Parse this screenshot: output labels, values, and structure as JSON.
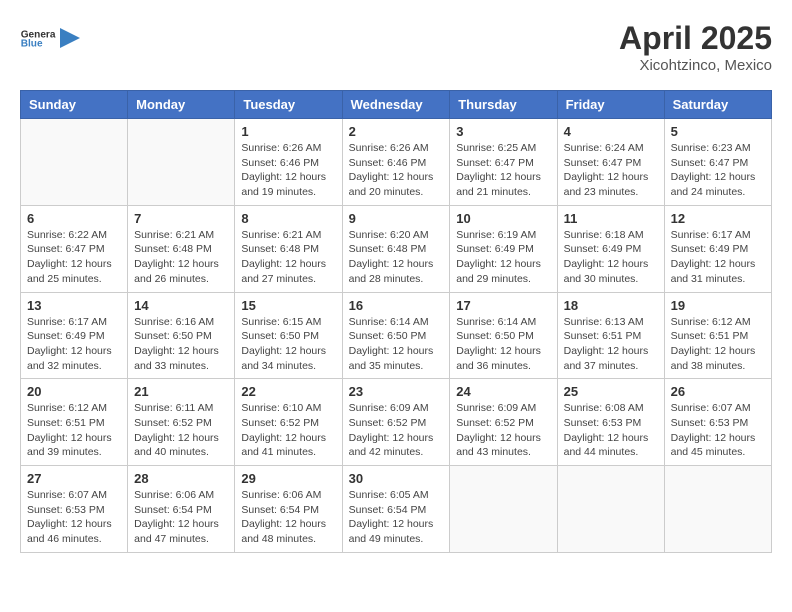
{
  "header": {
    "logo_line1": "General",
    "logo_line2": "Blue",
    "title": "April 2025",
    "subtitle": "Xicohtzinco, Mexico"
  },
  "weekdays": [
    "Sunday",
    "Monday",
    "Tuesday",
    "Wednesday",
    "Thursday",
    "Friday",
    "Saturday"
  ],
  "weeks": [
    [
      {
        "day": "",
        "sunrise": "",
        "sunset": "",
        "daylight": ""
      },
      {
        "day": "",
        "sunrise": "",
        "sunset": "",
        "daylight": ""
      },
      {
        "day": "1",
        "sunrise": "Sunrise: 6:26 AM",
        "sunset": "Sunset: 6:46 PM",
        "daylight": "Daylight: 12 hours and 19 minutes."
      },
      {
        "day": "2",
        "sunrise": "Sunrise: 6:26 AM",
        "sunset": "Sunset: 6:46 PM",
        "daylight": "Daylight: 12 hours and 20 minutes."
      },
      {
        "day": "3",
        "sunrise": "Sunrise: 6:25 AM",
        "sunset": "Sunset: 6:47 PM",
        "daylight": "Daylight: 12 hours and 21 minutes."
      },
      {
        "day": "4",
        "sunrise": "Sunrise: 6:24 AM",
        "sunset": "Sunset: 6:47 PM",
        "daylight": "Daylight: 12 hours and 23 minutes."
      },
      {
        "day": "5",
        "sunrise": "Sunrise: 6:23 AM",
        "sunset": "Sunset: 6:47 PM",
        "daylight": "Daylight: 12 hours and 24 minutes."
      }
    ],
    [
      {
        "day": "6",
        "sunrise": "Sunrise: 6:22 AM",
        "sunset": "Sunset: 6:47 PM",
        "daylight": "Daylight: 12 hours and 25 minutes."
      },
      {
        "day": "7",
        "sunrise": "Sunrise: 6:21 AM",
        "sunset": "Sunset: 6:48 PM",
        "daylight": "Daylight: 12 hours and 26 minutes."
      },
      {
        "day": "8",
        "sunrise": "Sunrise: 6:21 AM",
        "sunset": "Sunset: 6:48 PM",
        "daylight": "Daylight: 12 hours and 27 minutes."
      },
      {
        "day": "9",
        "sunrise": "Sunrise: 6:20 AM",
        "sunset": "Sunset: 6:48 PM",
        "daylight": "Daylight: 12 hours and 28 minutes."
      },
      {
        "day": "10",
        "sunrise": "Sunrise: 6:19 AM",
        "sunset": "Sunset: 6:49 PM",
        "daylight": "Daylight: 12 hours and 29 minutes."
      },
      {
        "day": "11",
        "sunrise": "Sunrise: 6:18 AM",
        "sunset": "Sunset: 6:49 PM",
        "daylight": "Daylight: 12 hours and 30 minutes."
      },
      {
        "day": "12",
        "sunrise": "Sunrise: 6:17 AM",
        "sunset": "Sunset: 6:49 PM",
        "daylight": "Daylight: 12 hours and 31 minutes."
      }
    ],
    [
      {
        "day": "13",
        "sunrise": "Sunrise: 6:17 AM",
        "sunset": "Sunset: 6:49 PM",
        "daylight": "Daylight: 12 hours and 32 minutes."
      },
      {
        "day": "14",
        "sunrise": "Sunrise: 6:16 AM",
        "sunset": "Sunset: 6:50 PM",
        "daylight": "Daylight: 12 hours and 33 minutes."
      },
      {
        "day": "15",
        "sunrise": "Sunrise: 6:15 AM",
        "sunset": "Sunset: 6:50 PM",
        "daylight": "Daylight: 12 hours and 34 minutes."
      },
      {
        "day": "16",
        "sunrise": "Sunrise: 6:14 AM",
        "sunset": "Sunset: 6:50 PM",
        "daylight": "Daylight: 12 hours and 35 minutes."
      },
      {
        "day": "17",
        "sunrise": "Sunrise: 6:14 AM",
        "sunset": "Sunset: 6:50 PM",
        "daylight": "Daylight: 12 hours and 36 minutes."
      },
      {
        "day": "18",
        "sunrise": "Sunrise: 6:13 AM",
        "sunset": "Sunset: 6:51 PM",
        "daylight": "Daylight: 12 hours and 37 minutes."
      },
      {
        "day": "19",
        "sunrise": "Sunrise: 6:12 AM",
        "sunset": "Sunset: 6:51 PM",
        "daylight": "Daylight: 12 hours and 38 minutes."
      }
    ],
    [
      {
        "day": "20",
        "sunrise": "Sunrise: 6:12 AM",
        "sunset": "Sunset: 6:51 PM",
        "daylight": "Daylight: 12 hours and 39 minutes."
      },
      {
        "day": "21",
        "sunrise": "Sunrise: 6:11 AM",
        "sunset": "Sunset: 6:52 PM",
        "daylight": "Daylight: 12 hours and 40 minutes."
      },
      {
        "day": "22",
        "sunrise": "Sunrise: 6:10 AM",
        "sunset": "Sunset: 6:52 PM",
        "daylight": "Daylight: 12 hours and 41 minutes."
      },
      {
        "day": "23",
        "sunrise": "Sunrise: 6:09 AM",
        "sunset": "Sunset: 6:52 PM",
        "daylight": "Daylight: 12 hours and 42 minutes."
      },
      {
        "day": "24",
        "sunrise": "Sunrise: 6:09 AM",
        "sunset": "Sunset: 6:52 PM",
        "daylight": "Daylight: 12 hours and 43 minutes."
      },
      {
        "day": "25",
        "sunrise": "Sunrise: 6:08 AM",
        "sunset": "Sunset: 6:53 PM",
        "daylight": "Daylight: 12 hours and 44 minutes."
      },
      {
        "day": "26",
        "sunrise": "Sunrise: 6:07 AM",
        "sunset": "Sunset: 6:53 PM",
        "daylight": "Daylight: 12 hours and 45 minutes."
      }
    ],
    [
      {
        "day": "27",
        "sunrise": "Sunrise: 6:07 AM",
        "sunset": "Sunset: 6:53 PM",
        "daylight": "Daylight: 12 hours and 46 minutes."
      },
      {
        "day": "28",
        "sunrise": "Sunrise: 6:06 AM",
        "sunset": "Sunset: 6:54 PM",
        "daylight": "Daylight: 12 hours and 47 minutes."
      },
      {
        "day": "29",
        "sunrise": "Sunrise: 6:06 AM",
        "sunset": "Sunset: 6:54 PM",
        "daylight": "Daylight: 12 hours and 48 minutes."
      },
      {
        "day": "30",
        "sunrise": "Sunrise: 6:05 AM",
        "sunset": "Sunset: 6:54 PM",
        "daylight": "Daylight: 12 hours and 49 minutes."
      },
      {
        "day": "",
        "sunrise": "",
        "sunset": "",
        "daylight": ""
      },
      {
        "day": "",
        "sunrise": "",
        "sunset": "",
        "daylight": ""
      },
      {
        "day": "",
        "sunrise": "",
        "sunset": "",
        "daylight": ""
      }
    ]
  ]
}
